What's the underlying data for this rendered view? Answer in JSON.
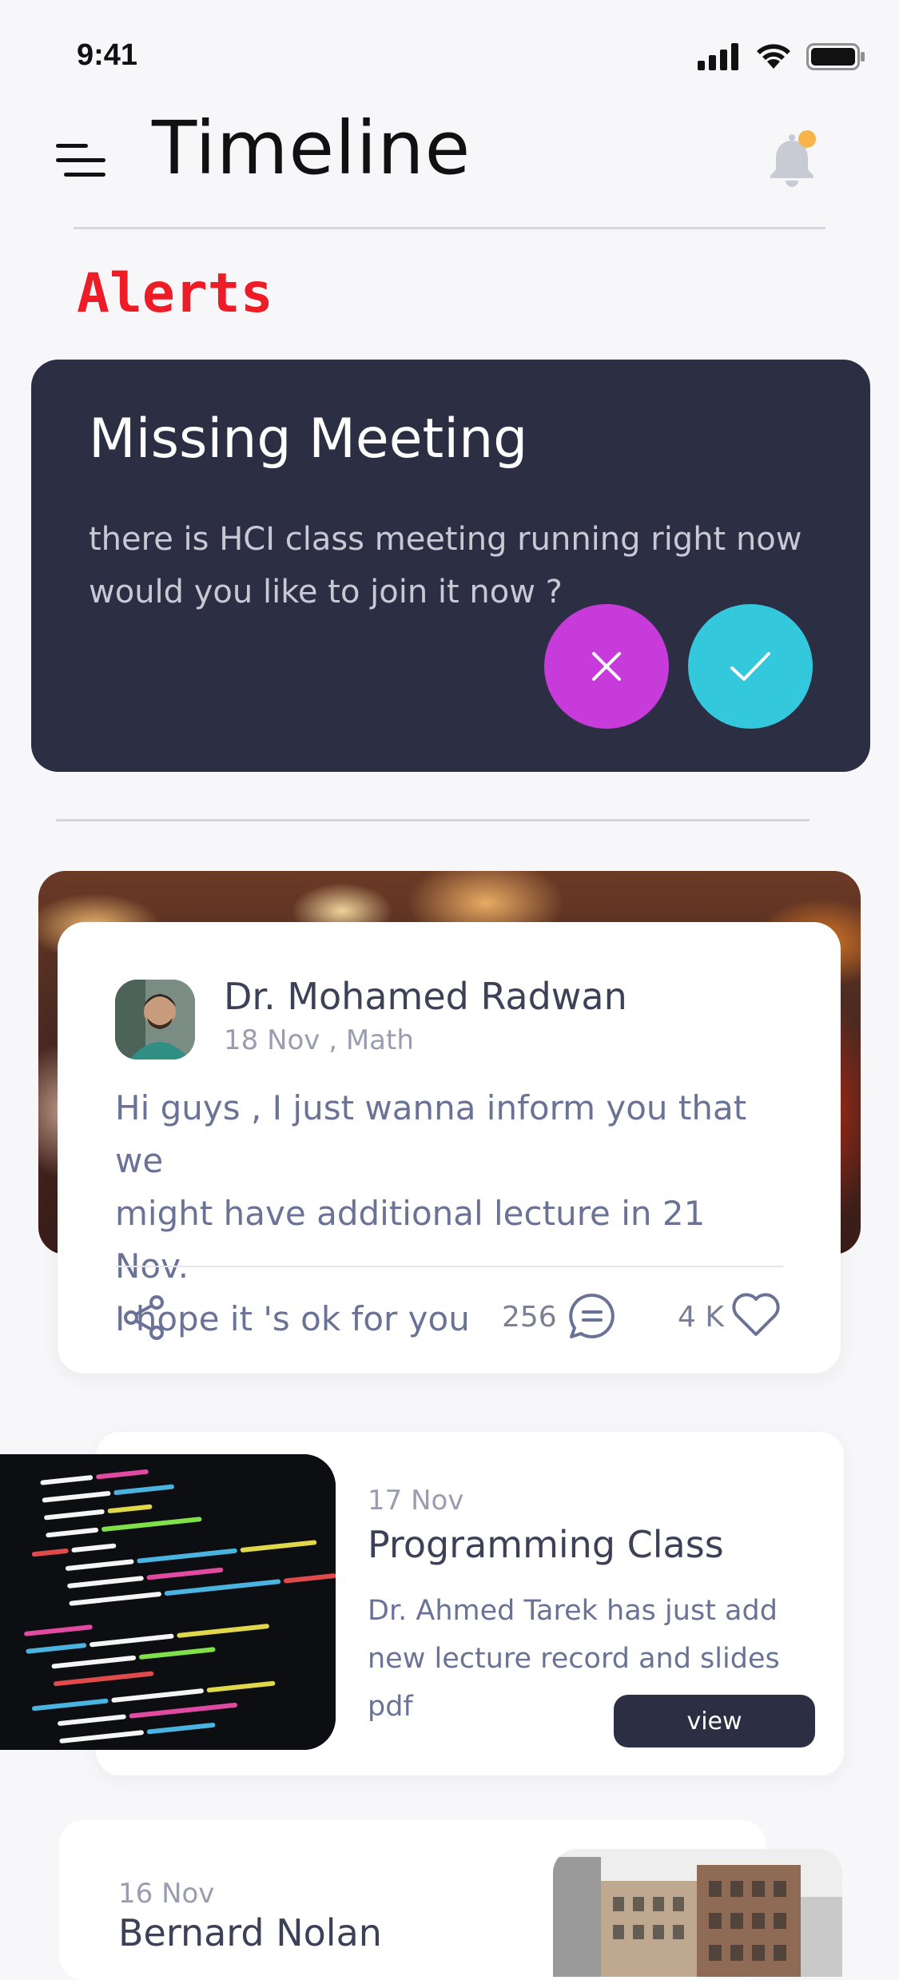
{
  "status_bar": {
    "time": "9:41"
  },
  "header": {
    "title": "Timeline"
  },
  "alerts": {
    "heading": "Alerts",
    "card": {
      "title": "Missing Meeting",
      "body": "there is HCI class meeting running right now would you like to join it now ?"
    }
  },
  "post": {
    "author": "Dr. Mohamed Radwan",
    "meta": "18 Nov , Math",
    "text_lines": [
      "Hi guys , I just wanna inform you that we",
      "might have additional lecture in 21 Nov.",
      "I hope it 's ok for you"
    ],
    "comments": "256",
    "likes": "4 K"
  },
  "class_card": {
    "date": "17 Nov",
    "title": "Programming Class",
    "description": "Dr. Ahmed Tarek has just add new lecture record and slides pdf",
    "button": "view"
  },
  "third_card": {
    "date": "16 Nov",
    "title": "Bernard Nolan"
  },
  "colors": {
    "accent_dark": "#2c2f44",
    "alert_red": "#ee1c27",
    "decline": "#c63bd9",
    "accept": "#33c8dc",
    "notification_dot": "#f6b44b"
  },
  "icons": {
    "menu": "menu-icon",
    "bell": "bell-icon",
    "close": "close-icon",
    "check": "check-icon",
    "share": "share-icon",
    "comment": "comment-icon",
    "heart": "heart-icon"
  }
}
